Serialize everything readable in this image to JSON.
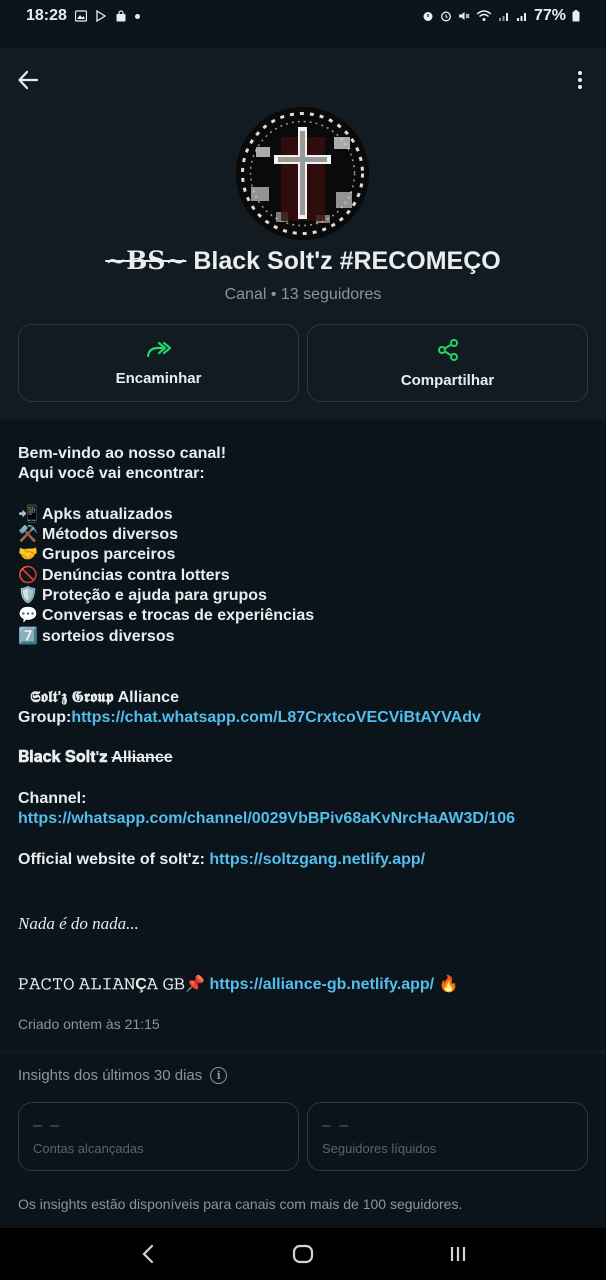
{
  "status_bar": {
    "time": "18:28",
    "battery": "77%"
  },
  "header": {
    "back_icon": "arrow-left-icon",
    "menu_icon": "more-vert-icon"
  },
  "channel": {
    "name_prefix": "~BS~",
    "name_rest": " Black Solt'z #RECOMEÇO",
    "subtitle": "Canal • 13 seguidores"
  },
  "actions": {
    "forward_label": "Encaminhar",
    "share_label": "Compartilhar",
    "accent": "#25d366"
  },
  "description": {
    "intro1": "Bem-vindo ao nosso canal!",
    "intro2": "Aqui você vai encontrar:",
    "items": [
      {
        "emoji": "📲",
        "text": "Apks atualizados"
      },
      {
        "emoji": "⚒️",
        "text": "Métodos diversos"
      },
      {
        "emoji": "🤝",
        "text": "Grupos parceiros"
      },
      {
        "emoji": "🚫",
        "text": "Denúncias contra lotters"
      },
      {
        "emoji": "🛡️",
        "text": "Proteção e ajuda para grupos"
      },
      {
        "emoji": "💬",
        "text": "Conversas e trocas de experiências"
      },
      {
        "emoji": "7️⃣",
        "text": "sorteios diversos"
      }
    ],
    "group_title": "𝕾𝖔𝖑𝖙'𝖟 𝕲𝖗𝖔𝖚𝖕 Alliance",
    "group_label": "Group:",
    "group_link": "https://chat.whatsapp.com/L87CrxtcoVECViBtAYVAdv",
    "alliance_title": "𝐁𝐥𝐚𝐜𝐤 𝐒𝐨𝐥𝐭'𝐳",
    "alliance_strike": "Alliance",
    "channel_label": "Channel:",
    "channel_link": "https://whatsapp.com/channel/0029VbBPiv68aKvNrcHaAW3D/106",
    "website_label": "Official website of solt'z: ",
    "website_link": "https://soltzgang.netlify.app/",
    "motto": "Nada é do nada...",
    "pact_label": "𝙿𝙰𝙲𝚃𝙾 𝙰𝙻𝙸𝙰𝙽Ç𝙰 𝙶𝙱",
    "pact_pin": "📌",
    "pact_link": "https://alliance-gb.netlify.app/",
    "pact_fire": "🔥"
  },
  "created": "Criado ontem às 21:15",
  "insights": {
    "title": "Insights dos últimos 30 dias",
    "accounts_value": "– –",
    "accounts_label": "Contas alcançadas",
    "followers_value": "– –",
    "followers_label": "Seguidores líquidos",
    "note": "Os insights estão disponíveis para canais com mais de 100 seguidores."
  }
}
